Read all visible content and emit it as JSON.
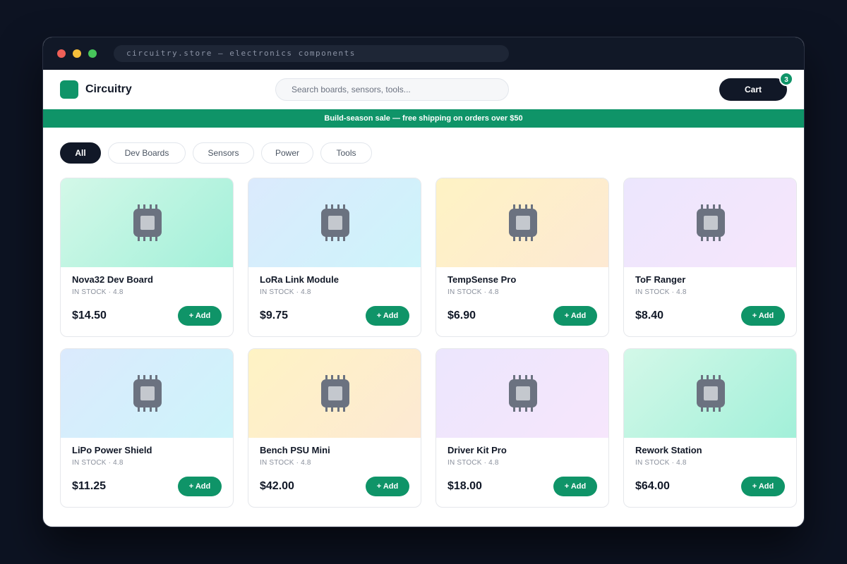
{
  "browser": {
    "url": "circuitry.store — electronics components"
  },
  "header": {
    "brand": "Circuitry",
    "search_placeholder": "Search boards, sensors, tools...",
    "cart_label": "Cart",
    "cart_count": "3"
  },
  "banner": {
    "text": "Build-season sale — free shipping on orders over $50"
  },
  "filters": [
    "All",
    "Dev Boards",
    "Sensors",
    "Power",
    "Tools"
  ],
  "active_filter": "All",
  "add_label": "+ Add",
  "colors": {
    "accent": "#0f9468",
    "dark": "#111827"
  },
  "products": [
    {
      "name": "Nova32 Dev Board",
      "meta": "IN STOCK · 4.8",
      "price": "$14.50",
      "grad": [
        "#d3f8e8",
        "#a2f0d9"
      ],
      "icon": "chip-icon"
    },
    {
      "name": "LoRa Link Module",
      "meta": "IN STOCK · 4.8",
      "price": "$9.75",
      "grad": [
        "#dbeafd",
        "#cdf4fa"
      ],
      "icon": "chip-icon"
    },
    {
      "name": "TempSense Pro",
      "meta": "IN STOCK · 4.8",
      "price": "$6.90",
      "grad": [
        "#fef3c4",
        "#fde9d3"
      ],
      "icon": "chip-icon"
    },
    {
      "name": "ToF Ranger",
      "meta": "IN STOCK · 4.8",
      "price": "$8.40",
      "grad": [
        "#ece6fd",
        "#f6e6fc"
      ],
      "icon": "chip-icon"
    },
    {
      "name": "LiPo Power Shield",
      "meta": "IN STOCK · 4.8",
      "price": "$11.25",
      "grad": [
        "#dbeafd",
        "#cdf4fa"
      ],
      "icon": "chip-icon"
    },
    {
      "name": "Bench PSU Mini",
      "meta": "IN STOCK · 4.8",
      "price": "$42.00",
      "grad": [
        "#fef3c4",
        "#fde9d3"
      ],
      "icon": "chip-icon"
    },
    {
      "name": "Driver Kit Pro",
      "meta": "IN STOCK · 4.8",
      "price": "$18.00",
      "grad": [
        "#ece6fd",
        "#f6e6fc"
      ],
      "icon": "chip-icon"
    },
    {
      "name": "Rework Station",
      "meta": "IN STOCK · 4.8",
      "price": "$64.00",
      "grad": [
        "#d3f8e8",
        "#a2f0d9"
      ],
      "icon": "chip-icon"
    }
  ]
}
